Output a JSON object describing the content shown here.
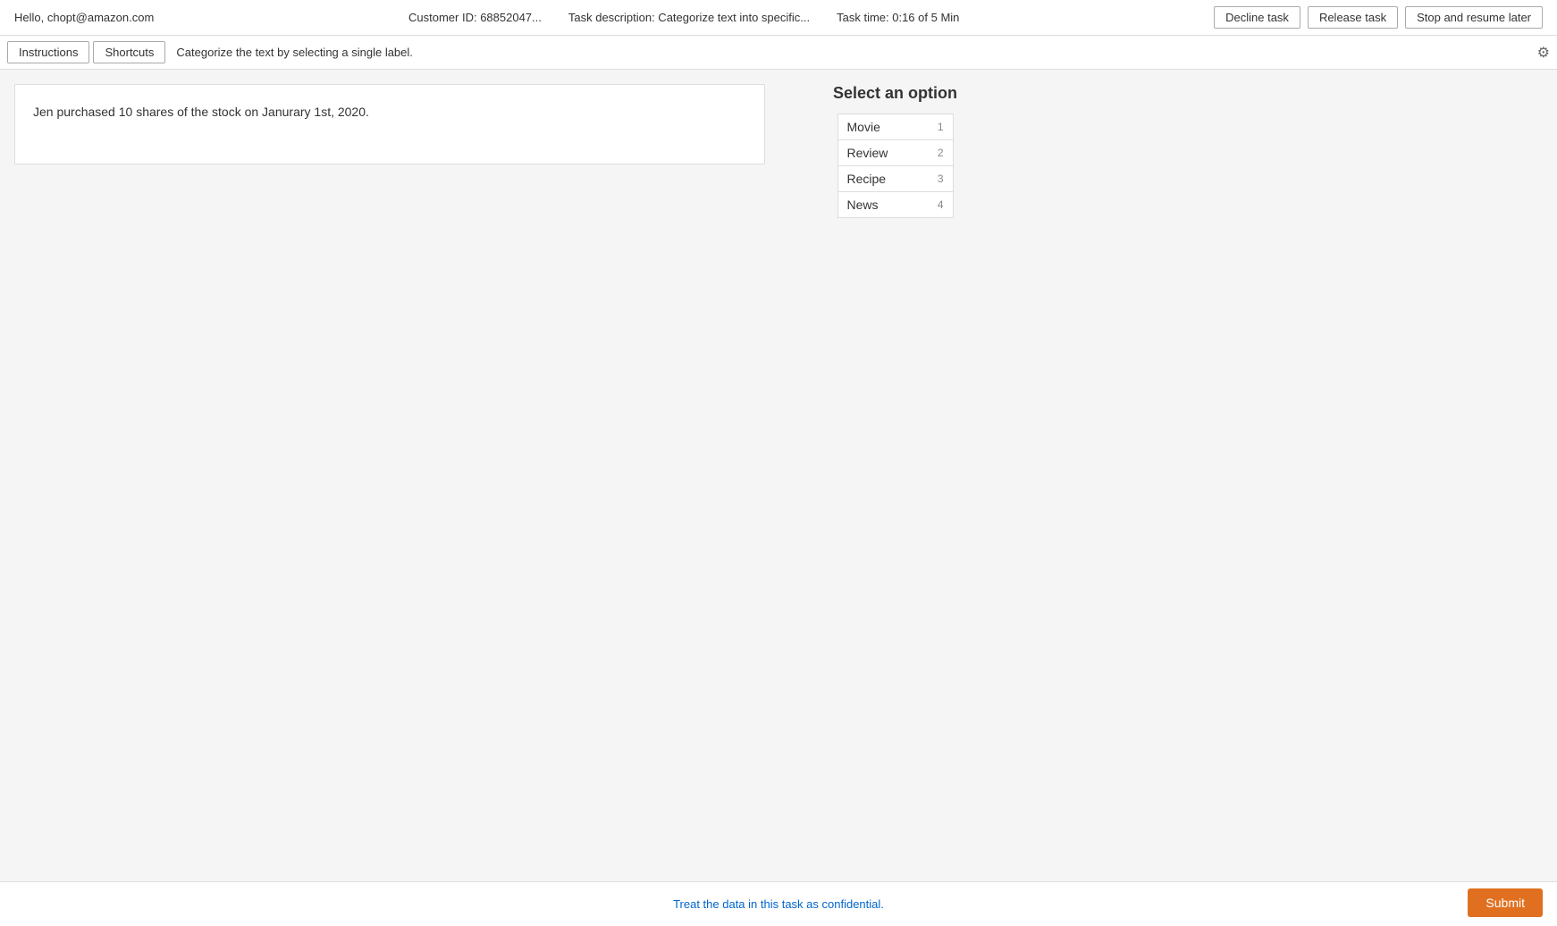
{
  "topbar": {
    "greeting": "Hello, chopt@amazon.com",
    "customer_id": "Customer ID: 68852047...",
    "task_description": "Task description: Categorize text into specific...",
    "task_time": "Task time: 0:16 of 5 Min",
    "decline_label": "Decline task",
    "release_label": "Release task",
    "stop_resume_label": "Stop and resume later"
  },
  "subheader": {
    "instructions_label": "Instructions",
    "shortcuts_label": "Shortcuts",
    "hint": "Categorize the text by selecting a single label.",
    "settings_icon": "⚙"
  },
  "main": {
    "text_content": "Jen purchased 10 shares of the stock on Janurary 1st, 2020."
  },
  "options": {
    "title": "Select an option",
    "items": [
      {
        "label": "Movie",
        "shortcut": "1"
      },
      {
        "label": "Review",
        "shortcut": "2"
      },
      {
        "label": "Recipe",
        "shortcut": "3"
      },
      {
        "label": "News",
        "shortcut": "4"
      }
    ]
  },
  "footer": {
    "confidential": "Treat the data in this task as confidential.",
    "submit_label": "Submit"
  }
}
